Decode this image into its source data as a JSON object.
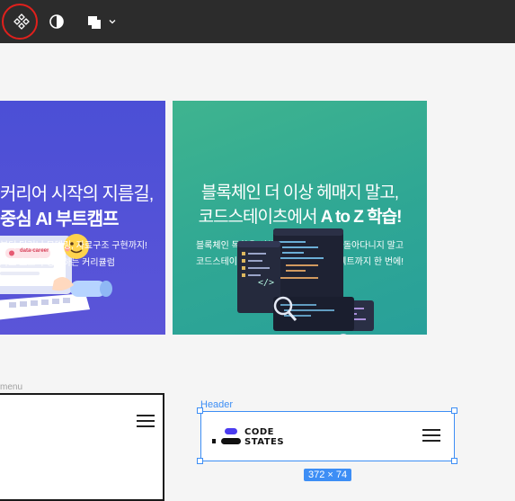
{
  "toolbar": {
    "tools": [
      {
        "icon": "component-icon",
        "annotated": true
      },
      {
        "icon": "contrast-icon"
      },
      {
        "icon": "boolean-operation-icon",
        "has_dropdown": true
      }
    ],
    "annotation_color": "#e0201c"
  },
  "banners": [
    {
      "line1": "커리어 시작의 지름길,",
      "line2": "중심 AI 부트캠프",
      "sub1": "부터 딥러닝 모델링, 자료구조 구현까지!",
      "sub2": "가로 초고속 성장하는 커리큘럼",
      "tag": "data-career",
      "background": "#4b4fd6"
    },
    {
      "title1": "블록체인 더 이상 헤매지 말고,",
      "title2_prefix": "코드스테이츠에서 ",
      "title2_bold": "A to Z 학습!",
      "sub1": "블록체인 독학을 위해서 유튜브, 블로그 돌아다니지 말고",
      "sub2": "코드스테이츠에서 기초부터 실무, 프로젝트까지 한 번에!",
      "background": "#2fa794"
    }
  ],
  "frames": {
    "menu_label": "menu",
    "header_label": "Header",
    "header_logo_line1": "CODE",
    "header_logo_line2": "STATES",
    "size_badge": "372 × 74",
    "selection_color": "#3d8ef5"
  }
}
